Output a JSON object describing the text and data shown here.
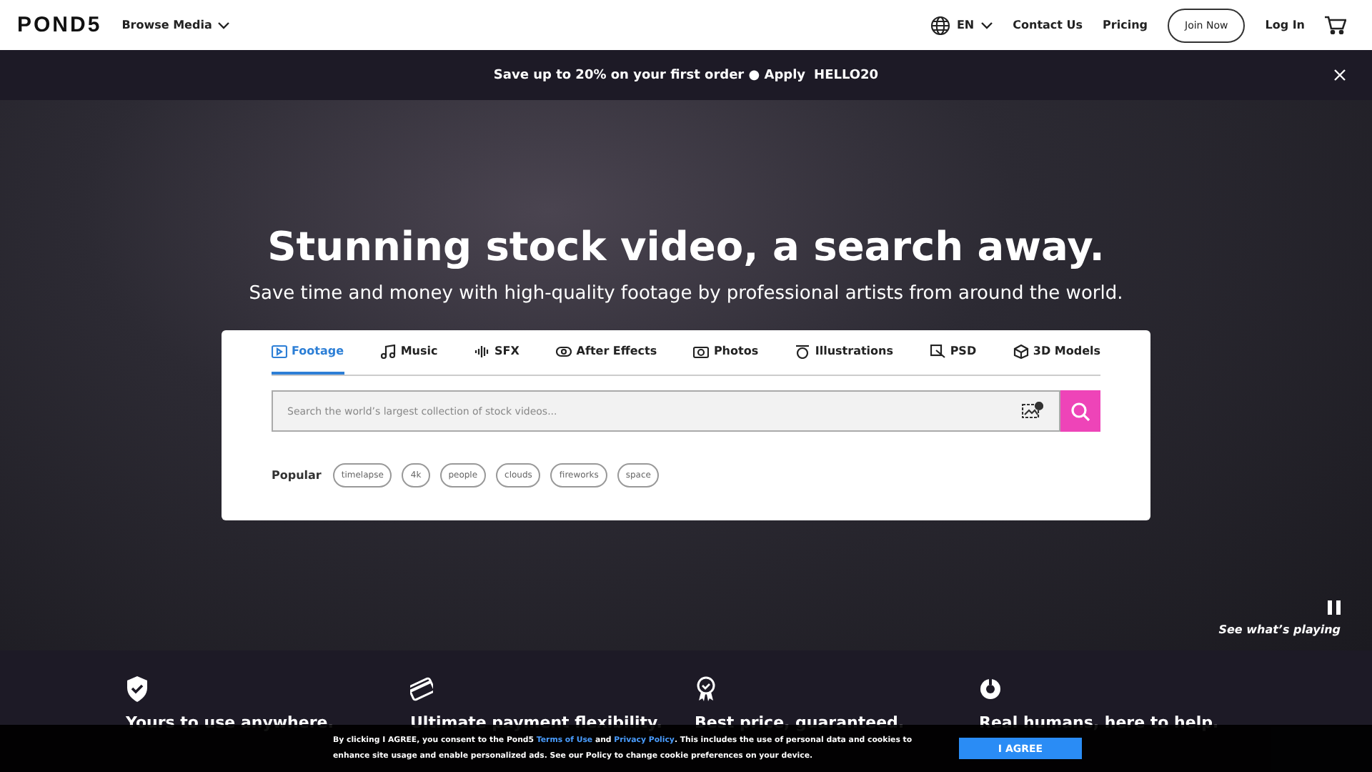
{
  "header": {
    "logo": "POND5",
    "browse": "Browse Media",
    "language": "EN",
    "links": [
      "Contact Us",
      "Pricing"
    ],
    "join": "Join Now",
    "login": "Log In"
  },
  "promo": {
    "text": "Save up to 20% on your first order ● Apply",
    "code": "HELLO20"
  },
  "hero": {
    "title": "Stunning stock video, a search away.",
    "subtitle": "Save time and money with high-quality footage by professional artists from around the world.",
    "see_playing": "See what’s playing"
  },
  "search": {
    "tabs": [
      {
        "label": "Footage",
        "kind": "footage",
        "selected": true
      },
      {
        "label": "Music",
        "kind": "music",
        "selected": false
      },
      {
        "label": "SFX",
        "kind": "sfx",
        "selected": false
      },
      {
        "label": "After Effects",
        "kind": "ae",
        "selected": false
      },
      {
        "label": "Photos",
        "kind": "photos",
        "selected": false
      },
      {
        "label": "Illustrations",
        "kind": "illustrations",
        "selected": false
      },
      {
        "label": "PSD",
        "kind": "psd",
        "selected": false
      },
      {
        "label": "3D Models",
        "kind": "model",
        "selected": false
      }
    ],
    "placeholder": "Search the world’s largest collection of stock videos...",
    "popular_label": "Popular",
    "popular": [
      "timelapse",
      "4k",
      "people",
      "clouds",
      "fireworks",
      "space"
    ]
  },
  "features": [
    {
      "kind": "shield",
      "title": "Yours to use anywhere."
    },
    {
      "kind": "card",
      "title": "Ultimate payment flexibility."
    },
    {
      "kind": "badge",
      "title": "Best price, guaranteed."
    },
    {
      "kind": "support",
      "title": "Real humans, here to help."
    }
  ],
  "cookie": {
    "text": "By clicking I AGREE, you consent to the Pond5 **Terms of Use** and **Privacy Policy**. This includes the use of personal data and cookies to enhance site usage and enable personalized ads. See our Policy to change cookie preferences on your device.",
    "button": "I AGREE"
  }
}
